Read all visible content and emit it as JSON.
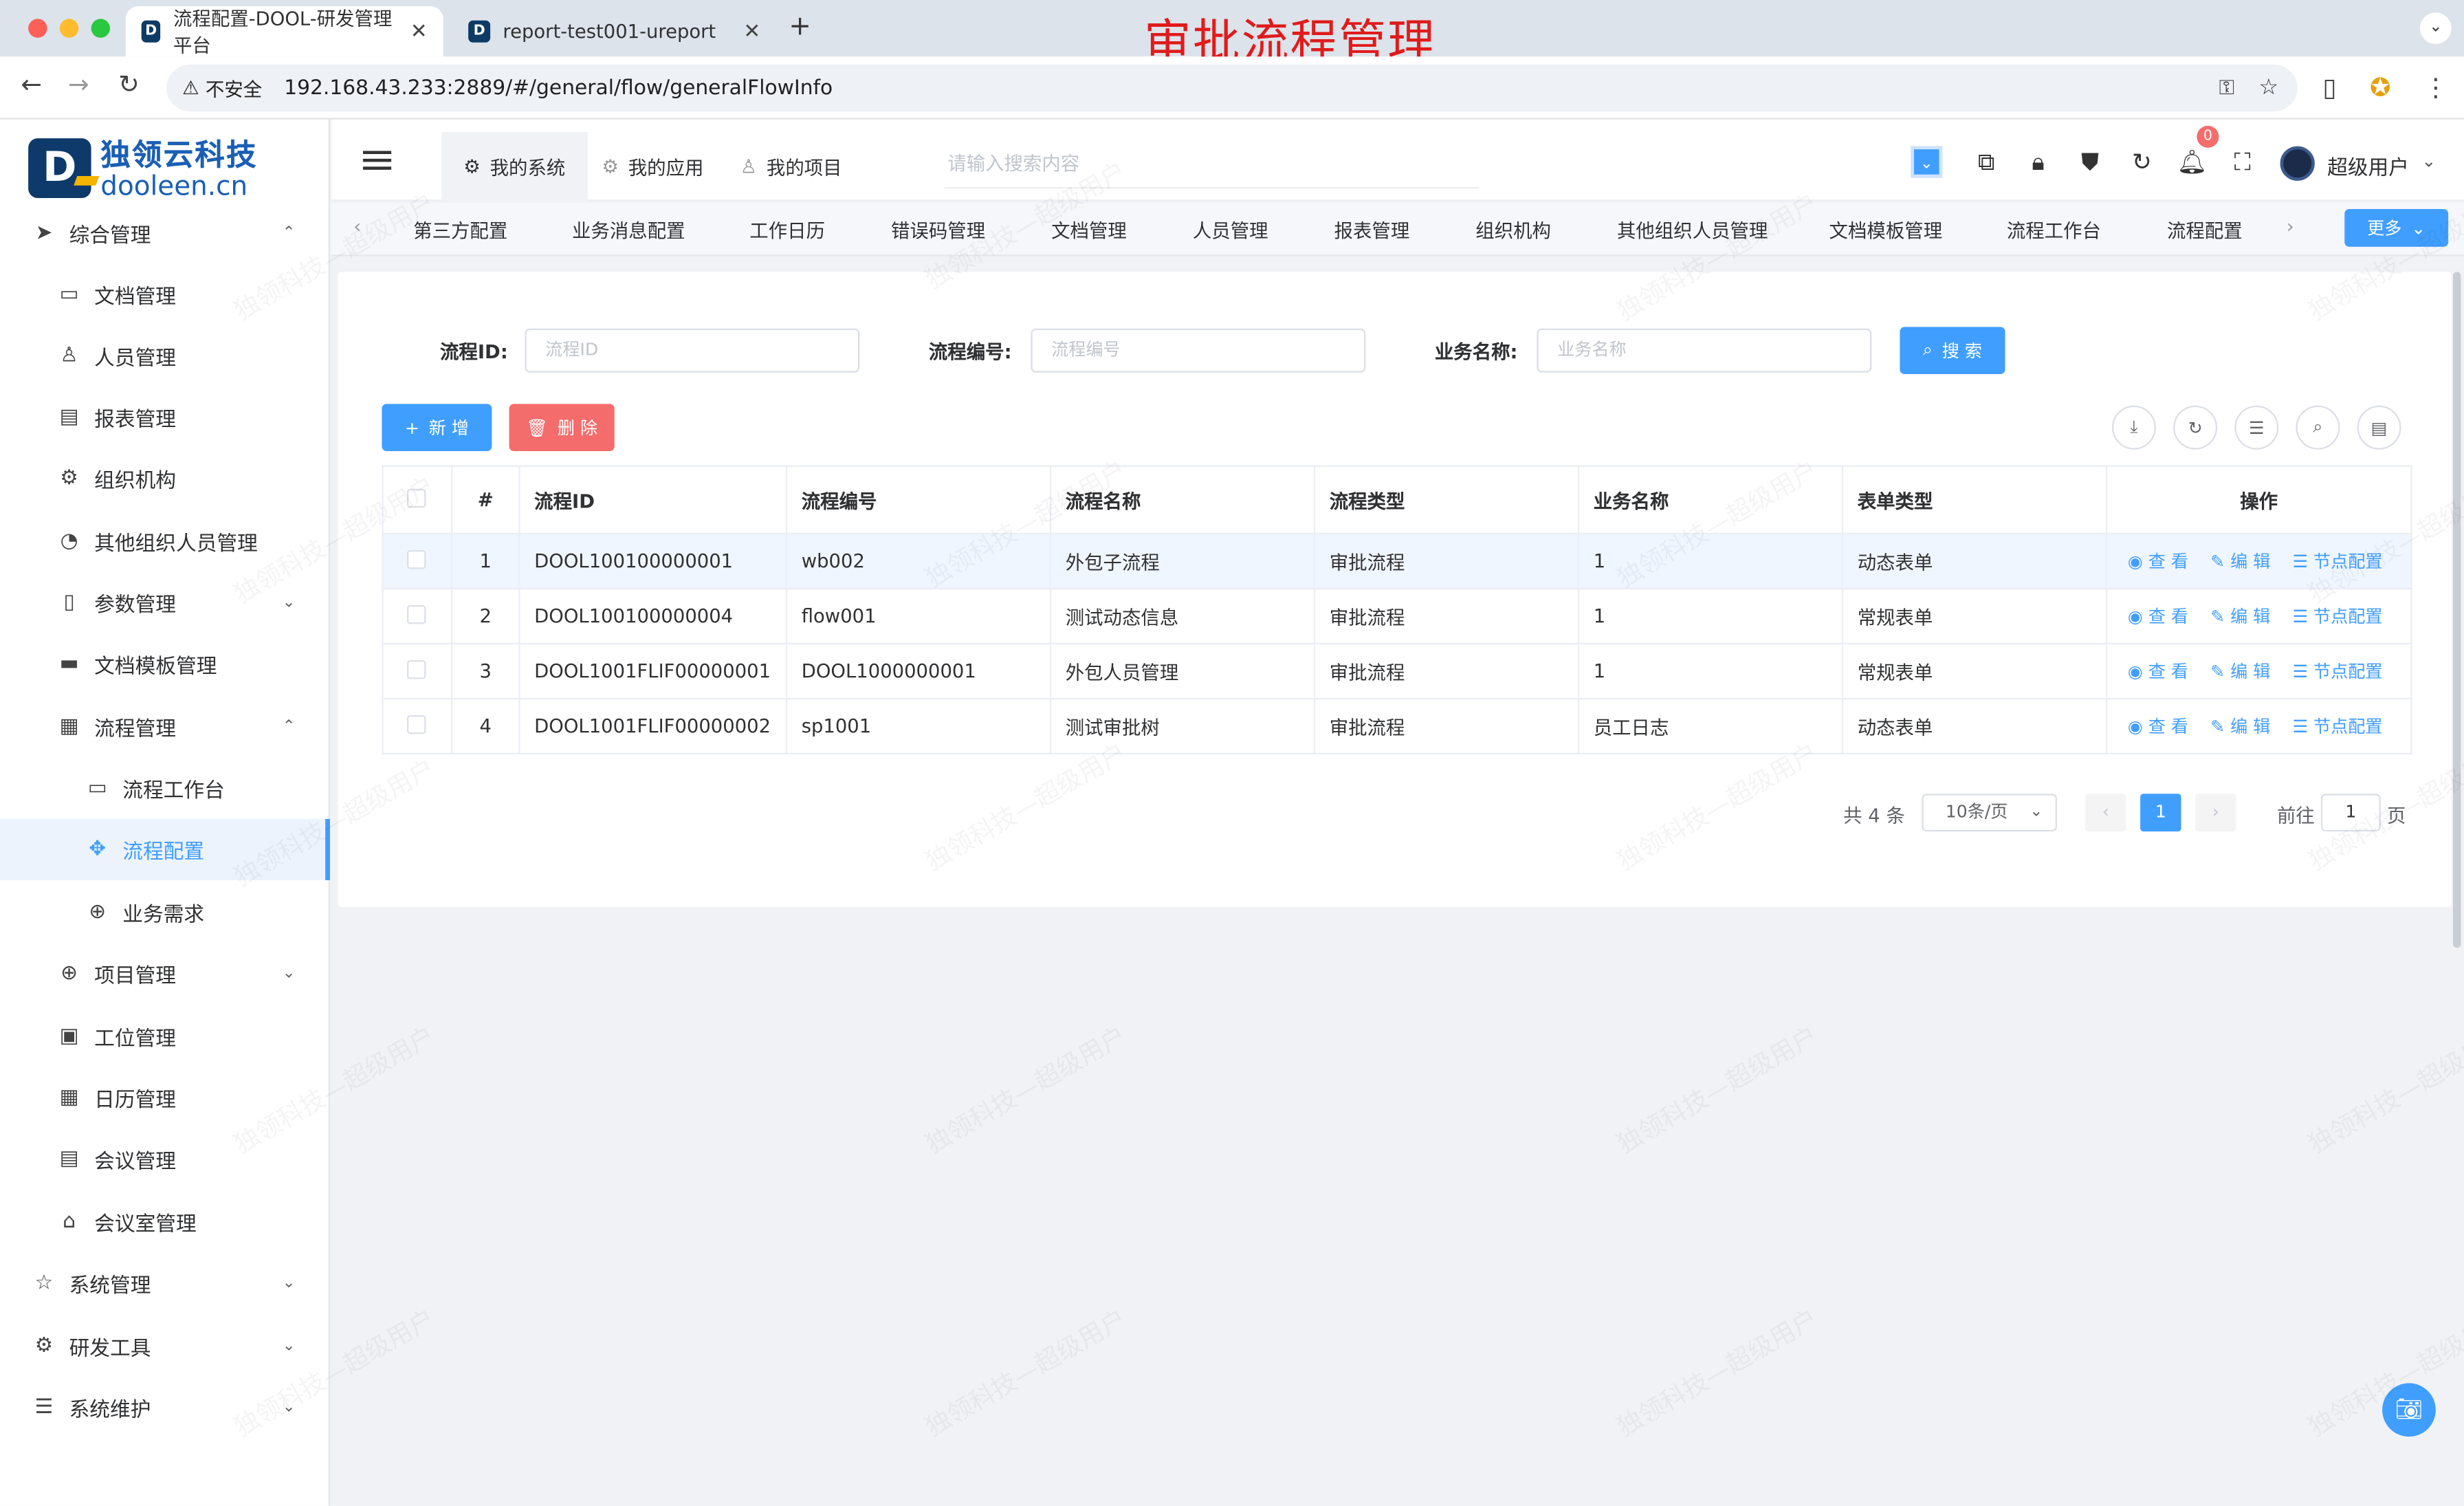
{
  "browser": {
    "tabs": [
      {
        "title": "流程配置-DOOL-研发管理平台"
      },
      {
        "title": "report-test001-ureport"
      }
    ],
    "new_tab": "+",
    "insecure_label": "不安全",
    "url": "192.168.43.233:2889/#/general/flow/generalFlowInfo"
  },
  "banner": "审批流程管理",
  "logo": {
    "cn": "独领云科技",
    "en": "dooleen.cn",
    "mark": "D"
  },
  "sidebar": {
    "items": [
      {
        "label": "综合管理",
        "icon": "send-icon",
        "arrow": "⌃"
      },
      {
        "label": "文档管理",
        "icon": "folder-icon"
      },
      {
        "label": "人员管理",
        "icon": "user-icon"
      },
      {
        "label": "报表管理",
        "icon": "report-icon"
      },
      {
        "label": "组织机构",
        "icon": "gear-icon"
      },
      {
        "label": "其他组织人员管理",
        "icon": "chart-icon"
      },
      {
        "label": "参数管理",
        "icon": "params-icon",
        "arrow": "⌄"
      },
      {
        "label": "文档模板管理",
        "icon": "template-icon"
      },
      {
        "label": "流程管理",
        "icon": "calendar-icon",
        "arrow": "⌃"
      },
      {
        "label": "流程工作台",
        "icon": "video-icon"
      },
      {
        "label": "流程配置",
        "icon": "move-icon"
      },
      {
        "label": "业务需求",
        "icon": "plus-circle-icon"
      },
      {
        "label": "项目管理",
        "icon": "plus-circle-icon",
        "arrow": "⌄"
      },
      {
        "label": "工位管理",
        "icon": "clipboard-icon"
      },
      {
        "label": "日历管理",
        "icon": "calendar-icon"
      },
      {
        "label": "会议管理",
        "icon": "doc-icon"
      },
      {
        "label": "会议室管理",
        "icon": "home-icon"
      },
      {
        "label": "系统管理",
        "icon": "star-icon",
        "arrow": "⌄"
      },
      {
        "label": "研发工具",
        "icon": "gear-icon",
        "arrow": "⌄"
      },
      {
        "label": "系统维护",
        "icon": "sliders-icon",
        "arrow": "⌄"
      }
    ]
  },
  "topbar": {
    "sys_tabs": [
      "我的系统",
      "我的应用",
      "我的项目"
    ],
    "search_placeholder": "请输入搜索内容",
    "badge_count": "0",
    "username": "超级用户"
  },
  "navtabs": [
    "第三方配置",
    "业务消息配置",
    "工作日历",
    "错误码管理",
    "文档管理",
    "人员管理",
    "报表管理",
    "组织机构",
    "其他组织人员管理",
    "文档模板管理",
    "流程工作台",
    "流程配置"
  ],
  "more_label": "更多",
  "filters": {
    "flow_id_label": "流程ID:",
    "flow_id_placeholder": "流程ID",
    "flow_code_label": "流程编号:",
    "flow_code_placeholder": "流程编号",
    "biz_name_label": "业务名称:",
    "biz_name_placeholder": "业务名称",
    "search_label": "搜 索"
  },
  "actions": {
    "add_label": "新 增",
    "delete_label": "删 除"
  },
  "table": {
    "headers": [
      "#",
      "流程ID",
      "流程编号",
      "流程名称",
      "流程类型",
      "业务名称",
      "表单类型",
      "操作"
    ],
    "rows": [
      [
        "1",
        "DOOL100100000001",
        "wb002",
        "外包子流程",
        "审批流程",
        "1",
        "动态表单"
      ],
      [
        "2",
        "DOOL100100000004",
        "flow001",
        "测试动态信息",
        "审批流程",
        "1",
        "常规表单"
      ],
      [
        "3",
        "DOOL1001FLIF00000001",
        "DOOL1000000001",
        "外包人员管理",
        "审批流程",
        "1",
        "常规表单"
      ],
      [
        "4",
        "DOOL1001FLIF00000002",
        "sp1001",
        "测试审批树",
        "审批流程",
        "员工日志",
        "动态表单"
      ]
    ],
    "op_view": "查 看",
    "op_edit": "编 辑",
    "op_node": "节点配置"
  },
  "pagination": {
    "total": "共 4 条",
    "page_size": "10条/页",
    "current": "1",
    "goto_label": "前往",
    "goto_value": "1",
    "page_unit": "页"
  },
  "watermark": "独领科技—超级用户",
  "colors": {
    "primary": "#409eff",
    "danger": "#f56c6c",
    "banner": "#e01b1b"
  }
}
